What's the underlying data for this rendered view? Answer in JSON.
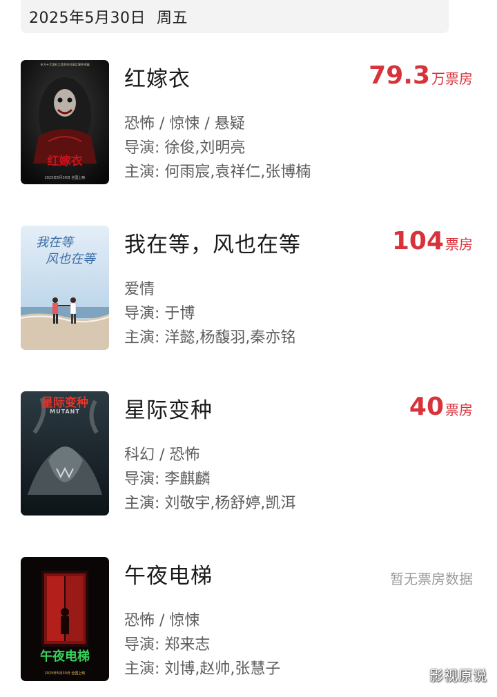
{
  "header": {
    "date": "2025年5月30日",
    "weekday": "周五"
  },
  "movies": [
    {
      "title": "红嫁衣",
      "genre": "恐怖 / 惊悚 / 悬疑",
      "director": "导演: 徐俊,刘明亮",
      "cast": "主演: 何雨宸,袁祥仁,张博楠",
      "box_value": "79.3",
      "box_unit": "万票房",
      "poster": {
        "top_text": "东方十大鬼村之首罗岸村真实事件改编",
        "title_text": "红嫁衣",
        "date_text": "2025年5月30日 全国上映"
      }
    },
    {
      "title": "我在等，风也在等",
      "genre": "爱情",
      "director": "导演: 于博",
      "cast": "主演: 洋懿,杨馥羽,秦亦铭",
      "box_value": "104",
      "box_unit": "票房",
      "poster": {
        "title_line1": "我在等",
        "title_line2": "风也在等"
      }
    },
    {
      "title": "星际变种",
      "genre": "科幻 / 恐怖",
      "director": "导演: 李麒麟",
      "cast": "主演: 刘敬宇,杨舒婷,凯洱",
      "box_value": "40",
      "box_unit": "票房",
      "poster": {
        "title_text": "星际变种",
        "subtitle_text": "MUTANT"
      }
    },
    {
      "title": "午夜电梯",
      "genre": "恐怖 / 惊悚",
      "director": "导演: 郑来志",
      "cast": "主演: 刘博,赵帅,张慧子",
      "box_none": "暂无票房数据",
      "poster": {
        "title_text": "午夜电梯",
        "date_text": "2025年5月30日 全国上映"
      }
    }
  ],
  "watermark": "影视原说",
  "colors": {
    "box_office": "#d8323a",
    "meta_text": "#5d5d5d",
    "date_bar_bg": "#f3f3f3"
  }
}
